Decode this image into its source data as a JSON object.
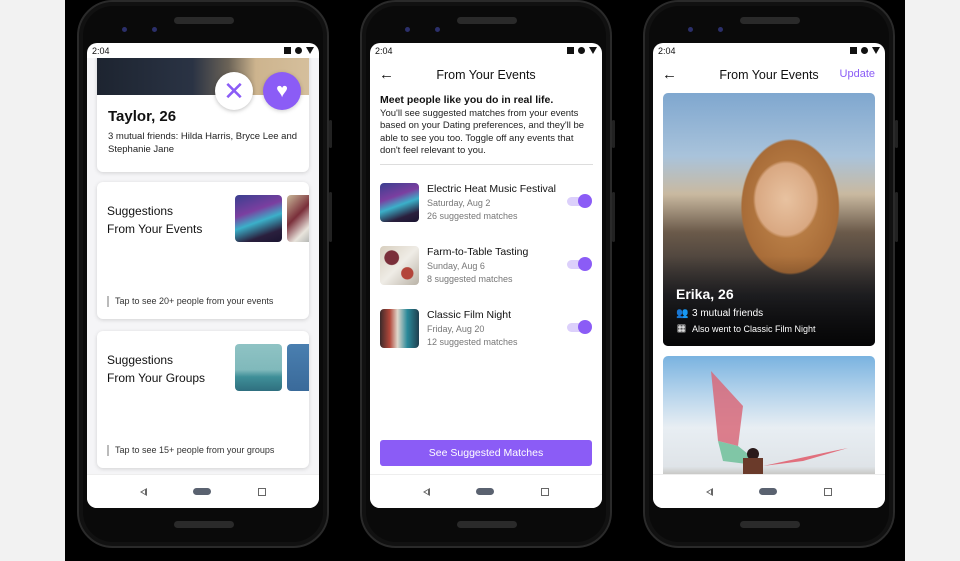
{
  "status_bar": {
    "time": "2:04"
  },
  "screen1": {
    "profile": {
      "name": "Taylor, 26",
      "mutual": "3 mutual friends: Hilda Harris, Bryce Lee and Stephanie Jane",
      "dismiss_icon": "✕",
      "like_icon": "♥"
    },
    "cards": [
      {
        "title_line1": "Suggestions",
        "title_line2": "From Your Events",
        "footer": "Tap to see 20+ people from your events"
      },
      {
        "title_line1": "Suggestions",
        "title_line2": "From Your Groups",
        "footer": "Tap to see 15+ people from your groups"
      }
    ]
  },
  "screen2": {
    "title": "From Your Events",
    "back_icon": "←",
    "intro_heading": "Meet people like you do in real life.",
    "intro_body": "You'll see suggested matches from your events based on your Dating preferences, and they'll be able to see you too. Toggle off any events that don't feel relevant to you.",
    "events": [
      {
        "name": "Electric Heat Music Festival",
        "date": "Saturday, Aug 2",
        "count": "26 suggested matches",
        "enabled": true
      },
      {
        "name": "Farm-to-Table Tasting",
        "date": "Sunday, Aug 6",
        "count": "8 suggested matches",
        "enabled": true
      },
      {
        "name": "Classic Film Night",
        "date": "Friday, Aug 20",
        "count": "12 suggested matches",
        "enabled": true
      }
    ],
    "cta": "See Suggested Matches"
  },
  "screen3": {
    "title": "From Your Events",
    "back_icon": "←",
    "update": "Update",
    "match": {
      "name": "Erika, 26",
      "mutual": "3 mutual friends",
      "event": "Also went to Classic Film Night"
    }
  },
  "colors": {
    "accent": "#8b5cf6",
    "toggle_track": "#dcd0fb"
  }
}
